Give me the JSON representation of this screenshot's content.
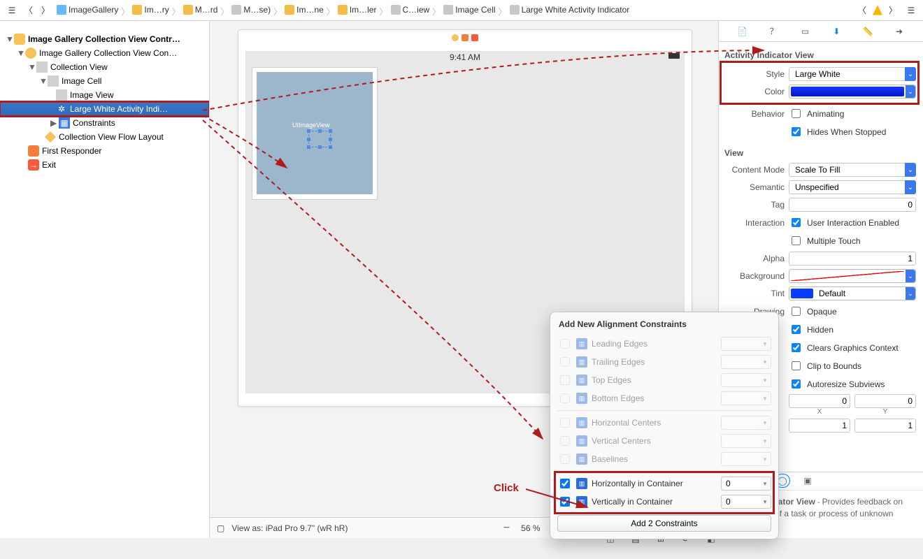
{
  "breadcrumbs": [
    {
      "label": "ImageGallery",
      "icon": "#66b8ff",
      "kind": "project"
    },
    {
      "label": "Im…ry",
      "icon": "#f5bd45",
      "kind": "folder"
    },
    {
      "label": "M…rd",
      "icon": "#f5bd45",
      "kind": "file"
    },
    {
      "label": "M…se)",
      "icon": "#c8c8c8",
      "kind": "storyboard"
    },
    {
      "label": "Im…ne",
      "icon": "#f5bd45",
      "kind": "scene"
    },
    {
      "label": "Im…ler",
      "icon": "#f5bd45",
      "kind": "controller"
    },
    {
      "label": "C…iew",
      "icon": "#c8c8c8",
      "kind": "view"
    },
    {
      "label": "Image Cell",
      "icon": "#c8c8c8",
      "kind": "cell"
    },
    {
      "label": "Large White Activity Indicator",
      "icon": "#c8c8c8",
      "kind": "indicator"
    }
  ],
  "tree": {
    "root": "Image Gallery Collection View Contr…",
    "items": [
      "Image Gallery Collection View Con…",
      "Collection View",
      "Image Cell",
      "Image View",
      "Large White Activity Indi…",
      "Constraints",
      "Collection View Flow Layout",
      "First Responder",
      "Exit"
    ]
  },
  "canvas": {
    "time": "9:41 AM",
    "selectionLabel": "UIImageView",
    "footer": {
      "viewAs": "View as: iPad Pro 9.7\" (wR hR)",
      "zoom": "56 %"
    }
  },
  "inspector": {
    "activityIndicator": {
      "title": "Activity Indicator View",
      "style": "Large White",
      "animating": "Animating",
      "hidesWhenStopped": "Hides When Stopped"
    },
    "view": {
      "title": "View",
      "contentMode": "Scale To Fill",
      "semantic": "Unspecified",
      "tag": "0",
      "userInteraction": "User Interaction Enabled",
      "multipleTouch": "Multiple Touch",
      "alpha": "1",
      "backgroundLabel": "Background",
      "tintLabel": "Tint",
      "tintDefault": "Default",
      "opaque": "Opaque",
      "hidden": "Hidden",
      "clearsGraphics": "Clears Graphics Context",
      "clipToBounds": "Clip to Bounds",
      "autoresize": "Autoresize Subviews",
      "x": "0",
      "y": "0",
      "w": "1",
      "h": "1",
      "labels": {
        "style": "Style",
        "color": "Color",
        "behavior": "Behavior",
        "contentMode": "Content Mode",
        "semantic": "Semantic",
        "tag": "Tag",
        "interaction": "Interaction",
        "alpha": "Alpha",
        "drawing": "Drawing",
        "X": "X",
        "Y": "Y"
      }
    },
    "help": {
      "title": "Activity Indicator View",
      "body": "Provides feedback on the progress of a task or process of unknown duration."
    }
  },
  "popover": {
    "title": "Add New Alignment Constraints",
    "rows": [
      {
        "label": "Leading Edges",
        "enabled": false
      },
      {
        "label": "Trailing Edges",
        "enabled": false
      },
      {
        "label": "Top Edges",
        "enabled": false
      },
      {
        "label": "Bottom Edges",
        "enabled": false
      },
      {
        "label": "Horizontal Centers",
        "enabled": false
      },
      {
        "label": "Vertical Centers",
        "enabled": false
      },
      {
        "label": "Baselines",
        "enabled": false
      },
      {
        "label": "Horizontally in Container",
        "enabled": true,
        "checked": true,
        "value": "0"
      },
      {
        "label": "Vertically in Container",
        "enabled": true,
        "checked": true,
        "value": "0"
      }
    ],
    "button": "Add 2 Constraints"
  },
  "annotation": {
    "click": "Click"
  }
}
